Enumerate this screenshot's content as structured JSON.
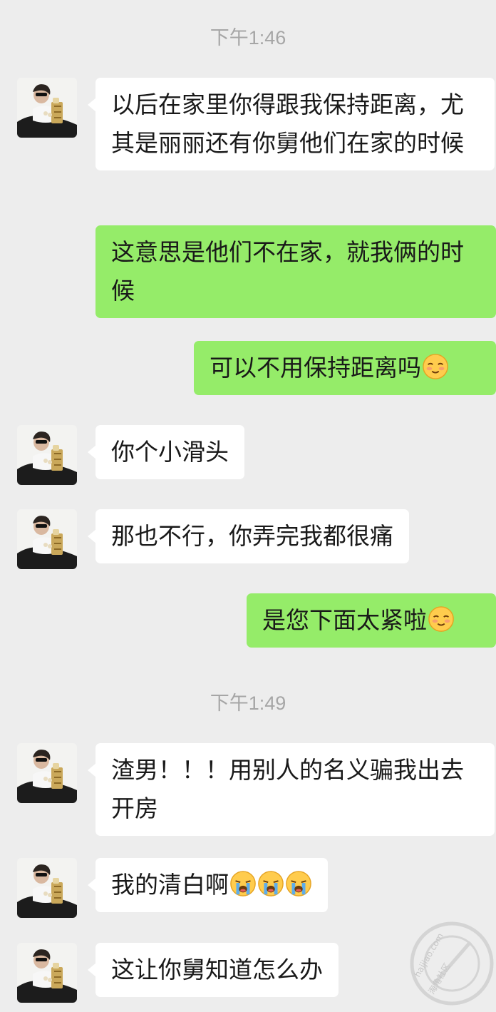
{
  "conversation": {
    "time_1": "下午1:46",
    "time_2": "下午1:49",
    "messages": [
      {
        "side": "in",
        "text": "以后在家里你得跟我保持距离，尤其是丽丽还有你舅他们在家的时候"
      },
      {
        "side": "out",
        "text": "这意思是他们不在家，就我俩的时候"
      },
      {
        "side": "out",
        "text": "可以不用保持距离吗",
        "emoji": "shy-smile-emoji"
      },
      {
        "side": "in",
        "text": "你个小滑头"
      },
      {
        "side": "in",
        "text": "那也不行，你弄完我都很痛"
      },
      {
        "side": "out",
        "text": "是您下面太紧啦",
        "emoji": "shy-smile-emoji"
      },
      {
        "side": "in",
        "text": "渣男！！！用别人的名义骗我出去开房"
      },
      {
        "side": "in",
        "text": "我的清白啊",
        "emoji": "crying-emoji x3"
      },
      {
        "side": "in",
        "text": "这让你舅知道怎么办"
      }
    ]
  },
  "watermark": {
    "text": "海角社区",
    "domain": "haijiao.com"
  },
  "colors": {
    "background": "#ededed",
    "incoming_bubble": "#ffffff",
    "outgoing_bubble": "#95ec69",
    "timestamp": "#a6a6a6",
    "text": "#191919"
  }
}
